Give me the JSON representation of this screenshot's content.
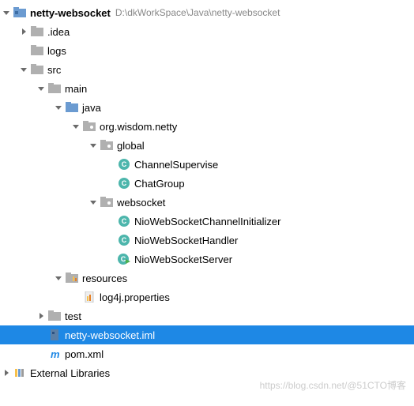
{
  "root": {
    "name": "netty-websocket",
    "path": "D:\\dkWorkSpace\\Java\\netty-websocket"
  },
  "tree": {
    "idea": ".idea",
    "logs": "logs",
    "src": "src",
    "main": "main",
    "java": "java",
    "package": "org.wisdom.netty",
    "global": "global",
    "channelSupervise": "ChannelSupervise",
    "chatGroup": "ChatGroup",
    "websocket": "websocket",
    "nioInitializer": "NioWebSocketChannelInitializer",
    "nioHandler": "NioWebSocketHandler",
    "nioServer": "NioWebSocketServer",
    "resources": "resources",
    "log4j": "log4j.properties",
    "test": "test",
    "iml": "netty-websocket.iml",
    "pom": "pom.xml",
    "externalLibs": "External Libraries"
  },
  "watermark": "https://blog.csdn.net/@51CTO博客"
}
